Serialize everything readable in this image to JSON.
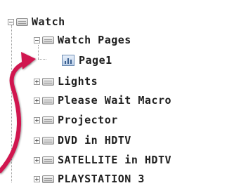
{
  "tree": {
    "root": {
      "label": "Watch",
      "icon": "folder-icon",
      "expanded": true
    },
    "child": {
      "label": "Watch Pages",
      "icon": "folder-icon",
      "expanded": true
    },
    "page": {
      "label": "Page1",
      "icon": "page-icon"
    },
    "items": [
      {
        "label": "Lights",
        "icon": "folder-icon",
        "expanded": false
      },
      {
        "label": "Please Wait Macro",
        "icon": "folder-icon",
        "expanded": false
      },
      {
        "label": "Projector",
        "icon": "folder-icon",
        "expanded": false
      },
      {
        "label": "DVD in HDTV",
        "icon": "folder-icon",
        "expanded": false
      },
      {
        "label": "SATELLITE in HDTV",
        "icon": "folder-icon",
        "expanded": false
      },
      {
        "label": "PLAYSTATION 3",
        "icon": "folder-icon",
        "expanded": false
      }
    ]
  },
  "annotation": {
    "icon": "curved-arrow-icon",
    "color": "#d0144f"
  }
}
